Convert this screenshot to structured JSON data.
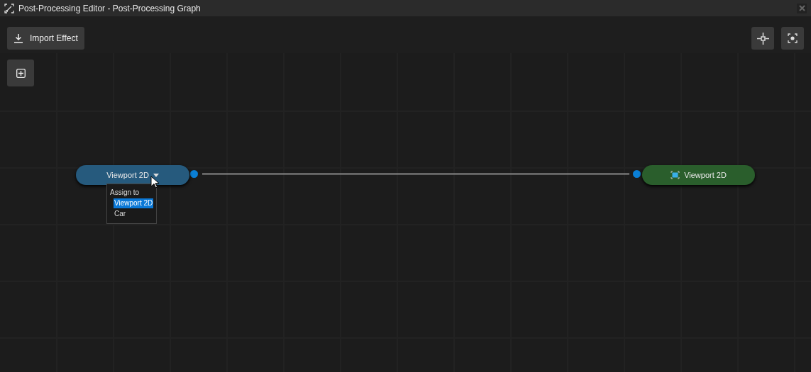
{
  "window": {
    "title": "Post-Processing Editor - Post-Processing Graph"
  },
  "toolbar": {
    "import_button": "Import Effect"
  },
  "graph": {
    "nodes": [
      {
        "kind": "source",
        "label": "Viewport 2D",
        "color": "#265a7d"
      },
      {
        "kind": "target",
        "label": "Viewport 2D",
        "color": "#2a5e2c"
      }
    ],
    "dropdown": {
      "title": "Assign to",
      "items": [
        {
          "label": "Viewport 2D",
          "selected": true
        },
        {
          "label": "Car",
          "selected": false
        }
      ]
    }
  }
}
